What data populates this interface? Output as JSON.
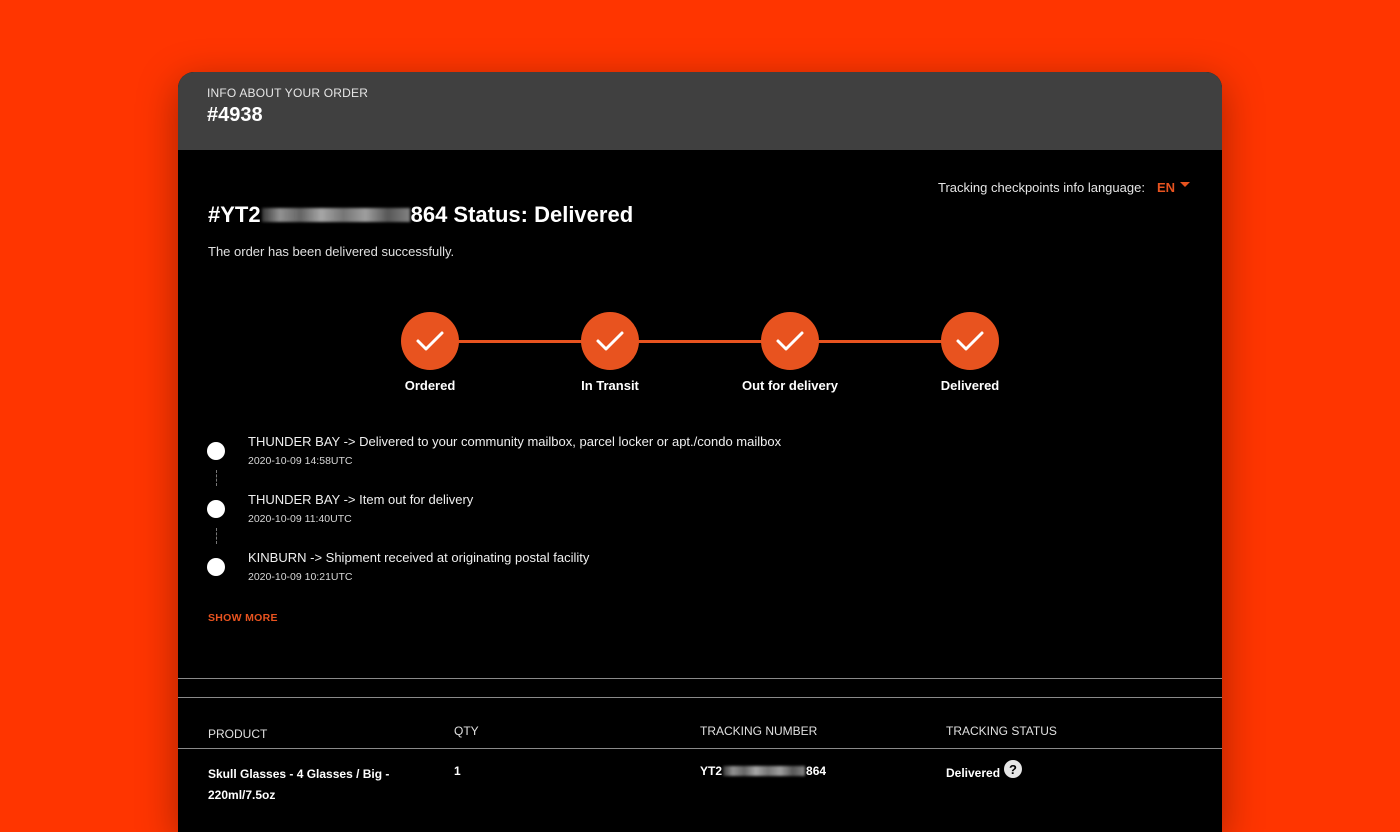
{
  "header": {
    "label": "INFO ABOUT YOUR ORDER",
    "order_number": "#4938"
  },
  "language": {
    "label": "Tracking checkpoints info language:",
    "selected": "EN"
  },
  "status": {
    "prefix": "#YT2",
    "suffix": "864 Status: Delivered",
    "description": "The order has been delivered successfully."
  },
  "steps": [
    {
      "label": "Ordered",
      "icon": "check-icon"
    },
    {
      "label": "In Transit",
      "icon": "check-icon"
    },
    {
      "label": "Out for delivery",
      "icon": "check-icon"
    },
    {
      "label": "Delivered",
      "icon": "check-icon"
    }
  ],
  "checkpoints": [
    {
      "event": "THUNDER BAY -> Delivered to your community mailbox, parcel locker or apt./condo mailbox",
      "time": "2020-10-09 14:58UTC"
    },
    {
      "event": "THUNDER BAY -> Item out for delivery",
      "time": "2020-10-09 11:40UTC"
    },
    {
      "event": "KINBURN -> Shipment received at originating postal facility",
      "time": "2020-10-09 10:21UTC"
    }
  ],
  "show_more_label": "SHOW MORE",
  "table": {
    "headers": {
      "product": "PRODUCT",
      "qty": "QTY",
      "tracking_number": "TRACKING NUMBER",
      "tracking_status": "TRACKING STATUS"
    },
    "rows": [
      {
        "product": "Skull Glasses - 4 Glasses / Big - 220ml/7.5oz",
        "qty": "1",
        "tracking_prefix": "YT2",
        "tracking_suffix": "864",
        "status": "Delivered",
        "help_icon": "?"
      }
    ]
  },
  "colors": {
    "background": "#ff3500",
    "accent": "#e8531f",
    "header_bg": "#404040",
    "card_bg": "#000000"
  }
}
